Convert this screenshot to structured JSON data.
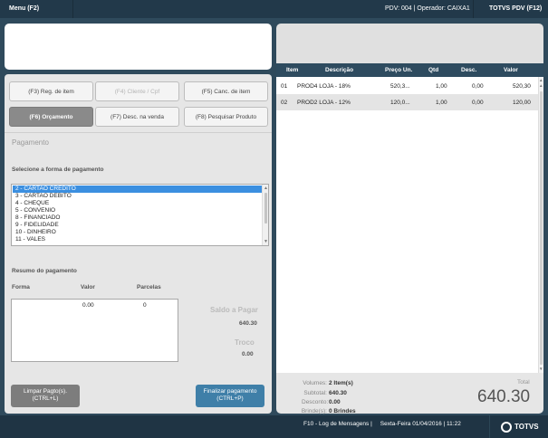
{
  "topbar": {
    "menu_label": "Menu (F2)",
    "pdv_info": "PDV: 004   |   Operador: CAIXA1",
    "totvs_pdv_label": "TOTVS PDV (F12)"
  },
  "buttons": {
    "reg_item": "(F3) Reg. de item",
    "cliente_cpf": "(F4) Cliente / Cpf",
    "canc_item": "(F5) Canc. de item",
    "orcamento": "(F6) Orçamento",
    "desc_venda": "(F7) Desc. na venda",
    "pesquisar_produto": "(F8) Pesquisar Produto"
  },
  "payment": {
    "section_title": "Pagamento",
    "select_label": "Selecione a forma de pagamento",
    "options": [
      "2 - CARTAO CREDITO",
      "3 - CARTAO DEBITO",
      "4 - CHEQUE",
      "5 - CONVENIO",
      "8 - FINANCIADO",
      "9 - FIDELIDADE",
      "10 - DINHEIRO",
      "11 - VALES"
    ],
    "summary_title": "Resumo do pagamento",
    "col_forma": "Forma",
    "col_valor": "Valor",
    "col_parcelas": "Parcelas",
    "row_valor": "0.00",
    "row_parcelas": "0",
    "saldo_label": "Saldo a Pagar",
    "saldo_value": "640.30",
    "troco_label": "Troco",
    "troco_value": "0.00",
    "limpar_label_1": "Limpar Pagto(s).",
    "limpar_label_2": "(CTRL+L)",
    "finalizar_label_1": "Finalizar pagamento",
    "finalizar_label_2": "(CTRL+P)"
  },
  "grid": {
    "headers": [
      "Item",
      "Descrição",
      "Preço Un.",
      "Qtd",
      "Desc.",
      "Valor"
    ],
    "rows": [
      {
        "item": "01",
        "descricao": "PROD4 LOJA - 18%",
        "preco": "520,3...",
        "qtd": "1,00",
        "desc": "0,00",
        "valor": "520,30"
      },
      {
        "item": "02",
        "descricao": "PROD2 LOJA - 12%",
        "preco": "120,0...",
        "qtd": "1,00",
        "desc": "0,00",
        "valor": "120,00"
      }
    ]
  },
  "totals": {
    "volumes_label": "Volumes:",
    "volumes_value": "2 Item(s)",
    "subtotal_label": "Subtotal:",
    "subtotal_value": "640.30",
    "desconto_label": "Desconto:",
    "desconto_value": "0.00",
    "brindes_label": "Brinde(s):",
    "brindes_value": "0 Brindes",
    "total_label": "Total",
    "total_value": "640.30"
  },
  "footer": {
    "status_text": "F10 - Log de Mensagens |     Sexta-Feira 01/04/2016 | 11:22",
    "logo_text": "TOTVS"
  },
  "colors": {
    "background": "#2f4a5c",
    "topbar": "#22394a",
    "selected": "#3b8fe0",
    "finalizar": "#3f7fa8"
  }
}
